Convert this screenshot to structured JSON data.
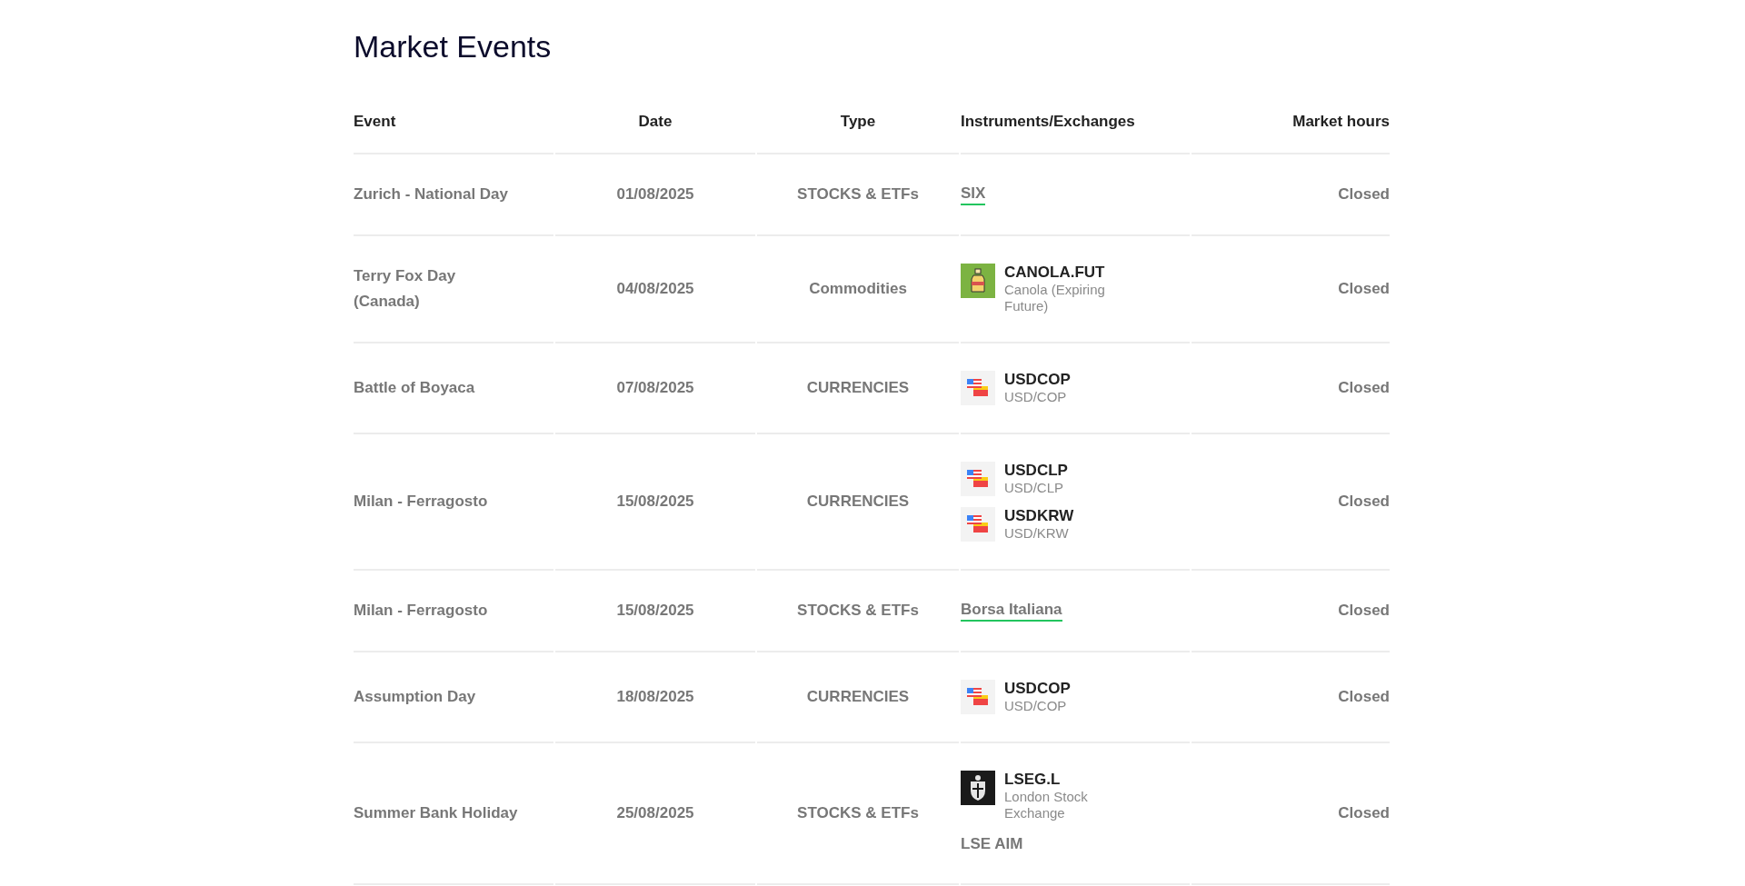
{
  "title": "Market Events",
  "columns": [
    "Event",
    "Date",
    "Type",
    "Instruments/Exchanges",
    "Market hours"
  ],
  "rows": [
    {
      "event": "Zurich - National Day",
      "date": "01/08/2025",
      "type": "STOCKS & ETFs",
      "instruments": [
        {
          "kind": "link",
          "label": "SIX"
        }
      ],
      "hours": "Closed"
    },
    {
      "event": "Terry Fox Day (Canada)",
      "date": "04/08/2025",
      "type": "Commodities",
      "instruments": [
        {
          "kind": "commodity",
          "symbol": "CANOLA.FUT",
          "name": "Canola (Expiring Future)"
        }
      ],
      "hours": "Closed"
    },
    {
      "event": "Battle of Boyaca",
      "date": "07/08/2025",
      "type": "CURRENCIES",
      "instruments": [
        {
          "kind": "currency",
          "symbol": "USDCOP",
          "name": "USD/COP"
        }
      ],
      "hours": "Closed"
    },
    {
      "event": "Milan - Ferragosto",
      "date": "15/08/2025",
      "type": "CURRENCIES",
      "instruments": [
        {
          "kind": "currency",
          "symbol": "USDCLP",
          "name": "USD/CLP"
        },
        {
          "kind": "currency",
          "symbol": "USDKRW",
          "name": "USD/KRW"
        }
      ],
      "hours": "Closed"
    },
    {
      "event": "Milan - Ferragosto",
      "date": "15/08/2025",
      "type": "STOCKS & ETFs",
      "instruments": [
        {
          "kind": "link",
          "label": "Borsa Italiana"
        }
      ],
      "hours": "Closed"
    },
    {
      "event": "Assumption Day",
      "date": "18/08/2025",
      "type": "CURRENCIES",
      "instruments": [
        {
          "kind": "currency",
          "symbol": "USDCOP",
          "name": "USD/COP"
        }
      ],
      "hours": "Closed"
    },
    {
      "event": "Summer Bank Holiday",
      "date": "25/08/2025",
      "type": "STOCKS & ETFs",
      "instruments": [
        {
          "kind": "exchange",
          "symbol": "LSEG.L",
          "name": "London Stock Exchange"
        },
        {
          "kind": "text",
          "label": "LSE AIM"
        }
      ],
      "hours": "Closed"
    }
  ]
}
